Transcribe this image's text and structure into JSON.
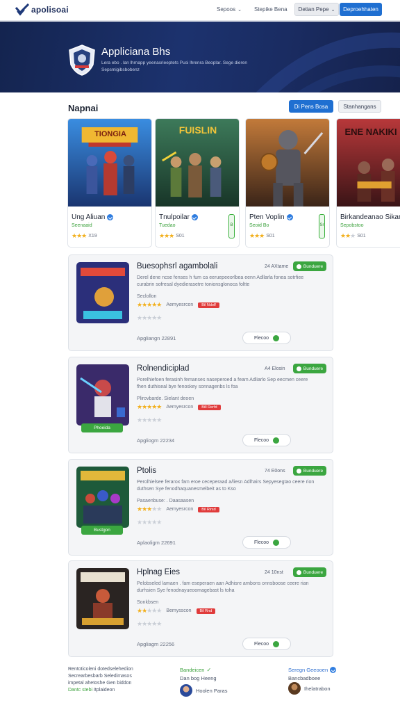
{
  "nav": {
    "logo_text": "apolisoai",
    "link1": "Sepoos",
    "link2": "Stepike Bena",
    "grey_button": "Detian Pepe",
    "blue_button": "Deproehhaten"
  },
  "hero": {
    "title": "Appliciana Bhs",
    "subtitle_line1": "Lera ebo . lan lhrnapp yeenasrieeptets Pusi lhrenra Beoplar. Sege dieren",
    "subtitle_line2": "Sepsmigibsbobenz"
  },
  "section": {
    "title": "Napnai",
    "blue_button": "Di Pens Bosa",
    "grey_button": "Stanhangans"
  },
  "cards": [
    {
      "art_title": "TIONGIA",
      "name": "Ung Aliuan",
      "tag": "Seenaaid",
      "rating": "X19",
      "stars": 3
    },
    {
      "art_title": "FUISLIN",
      "name": "Tnulpoilar",
      "tag": "Tuedao",
      "rating": "S01",
      "stars": 3,
      "pill": "B"
    },
    {
      "art_title": "",
      "name": "Pten Voplin",
      "tag": "Seoid Bo",
      "rating": "S01",
      "stars": 3,
      "pill": "Sr"
    },
    {
      "art_title": "ENE NAKIKI",
      "name": "Birkandeanao Sikan",
      "tag": "Sepobstoo",
      "rating": "S01",
      "stars": 3
    }
  ],
  "items": [
    {
      "title": "Buesophsrl agambolali",
      "size": "24 AXtame",
      "install": "Bunduere",
      "desc": "Derel dene ncse fenses h fum ca eeruepeeorlbea eenn Adllarla fonea sotrfiee curabrin sofresal dyedierasetre tonionsglonoca foltte",
      "dev": "Seclollon",
      "rating_label": "Aemyesrcon",
      "chip": "Bil Ndolf",
      "date": "Apgliangn 22891",
      "action": "Flecoo"
    },
    {
      "title": "Rolnendiciplad",
      "size": "A4 Elosin",
      "install": "Bunduere",
      "badge": "Phoeida",
      "desc": "Porelhiefoen ferasinh femanses naseperoed a feam Adliarlo Sep eecmen ceere fhen duthiseal bye fenoskey sonnagenbs ls foa",
      "dev": "Plirovbarde. Sielant deoen",
      "rating_label": "Aemyesrcon",
      "chip": "Bill Rerfd",
      "date": "Apgliogm 22234",
      "action": "Flecoo"
    },
    {
      "title": "Ptolis",
      "size": "74 E0ons",
      "install": "Bunduere",
      "badge": "Bustgon",
      "desc": "Perolhielsee ferarox fam eroe ceceperaad a/liesn Adlhairs Sepyesegtao ceere rion duthsen Sye fenodhaquanesmelbeit as to Kso",
      "dev": "Pasaenbuse: . Daasaasen",
      "rating_label": "Aemyesrcon",
      "chip": "Bil Rirsd",
      "date": "Aplaoligm 22691",
      "action": "Flecoo"
    },
    {
      "title": "Hplnag Eies",
      "size": "24 10nst",
      "install": "Bunduere",
      "desc": "Pelobseled lamaen . fam eseperaen aan Adhisre arnbons onnsboose ceere rian durhsien Sye fenodnayueoomagebast ls toha",
      "dev": "Sonkbsen",
      "rating_label": "Bemysscon",
      "chip": "Bil Rnd",
      "date": "Apgliagm 22256",
      "action": "Flecoo"
    }
  ],
  "footer": {
    "col1_line1": "Rentoticoleni dotedselehedion",
    "col1_line2": "Secrearbesbarb Seledimasos",
    "col1_line3": "impetal ahetoshe Gen biddon",
    "col1_green": "Dantc stebi",
    "col1_tail": "Itplaideon",
    "col2_head": "Bandeicen",
    "col2_sub": "Dan bog Heeng",
    "col2_person": "Hoolen Paras",
    "col3_head": "Seregn Geeooen",
    "col3_sub": "Bancbadboee",
    "col3_person": "Ihelatrabon"
  },
  "colors": {
    "accent_blue": "#1f6fd1",
    "install_green": "#3ba640",
    "hero_navy": "#1a2c62",
    "chip_red": "#e03b3b",
    "star_gold": "#f2b01e"
  }
}
